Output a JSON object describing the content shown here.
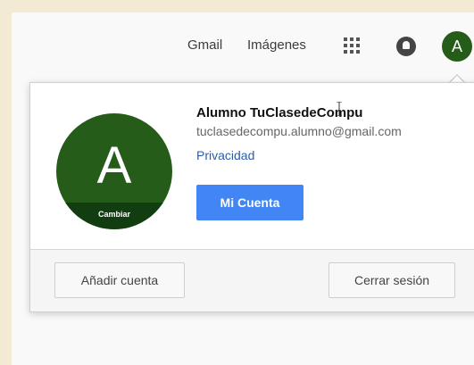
{
  "header": {
    "gmail_label": "Gmail",
    "images_label": "Imágenes",
    "avatar_letter": "A",
    "icons": [
      "apps-grid-icon",
      "notifications-icon"
    ]
  },
  "account_popup": {
    "avatar_letter": "A",
    "change_label": "Cambiar",
    "name": "Alumno TuClasedeCompu",
    "email": "tuclasedecompu.alumno@gmail.com",
    "privacy_label": "Privacidad",
    "my_account_label": "Mi Cuenta",
    "add_account_label": "Añadir cuenta",
    "sign_out_label": "Cerrar sesión"
  },
  "colors": {
    "avatar_green": "#265c1a",
    "primary_blue": "#4285f4",
    "link_blue": "#2a5db0"
  }
}
